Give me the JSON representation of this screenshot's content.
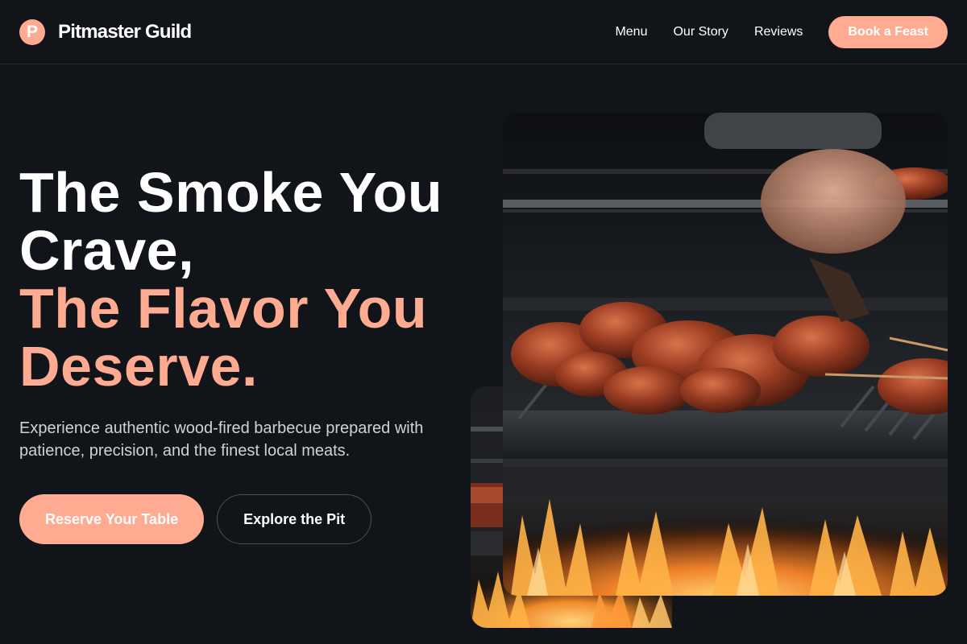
{
  "header": {
    "logo_letter": "P",
    "brand_name": "Pitmaster Guild",
    "nav_links": [
      "Menu",
      "Our Story",
      "Reviews"
    ],
    "cta_label": "Book a Feast"
  },
  "hero": {
    "headline_line1": "The Smoke You",
    "headline_line2": "Crave,",
    "headline_line3": "The Flavor You",
    "headline_line4": "Deserve.",
    "subtitle": "Experience authentic wood-fired barbecue prepared with patience, precision, and the finest local meats.",
    "primary_cta": "Reserve Your Table",
    "secondary_cta": "Explore the Pit"
  },
  "images": {
    "main": "bbq-grill-ribs-photo",
    "secondary": "grill-fire-photo"
  },
  "colors": {
    "background": "#111418",
    "accent": "#ffab91",
    "text": "#ffffff",
    "muted_text": "#cfd3d8"
  }
}
